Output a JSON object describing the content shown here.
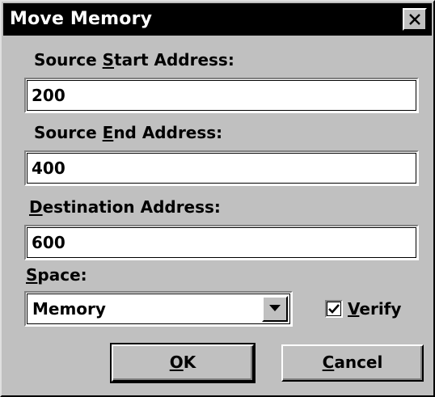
{
  "window": {
    "title": "Move Memory"
  },
  "source_start": {
    "label_pre": "Source ",
    "label_key": "S",
    "label_post": "tart Address:",
    "value": "200"
  },
  "source_end": {
    "label_pre": "Source ",
    "label_key": "E",
    "label_post": "nd Address:",
    "value": "400"
  },
  "destination": {
    "label_pre": "",
    "label_key": "D",
    "label_post": "estination Address:",
    "value": "600"
  },
  "space": {
    "label_key": "S",
    "label_post": "pace:",
    "selected": "Memory"
  },
  "verify": {
    "label_key": "V",
    "label_post": "erify",
    "checked": true
  },
  "buttons": {
    "ok_key": "O",
    "ok_post": "K",
    "cancel_key": "C",
    "cancel_post": "ancel"
  },
  "icons": {
    "close": "close-icon",
    "dropdown": "chevron-down-icon",
    "check": "check-icon"
  },
  "colors": {
    "face": "#c0c0c0",
    "titlebar": "#000000",
    "title_text": "#ffffff"
  }
}
